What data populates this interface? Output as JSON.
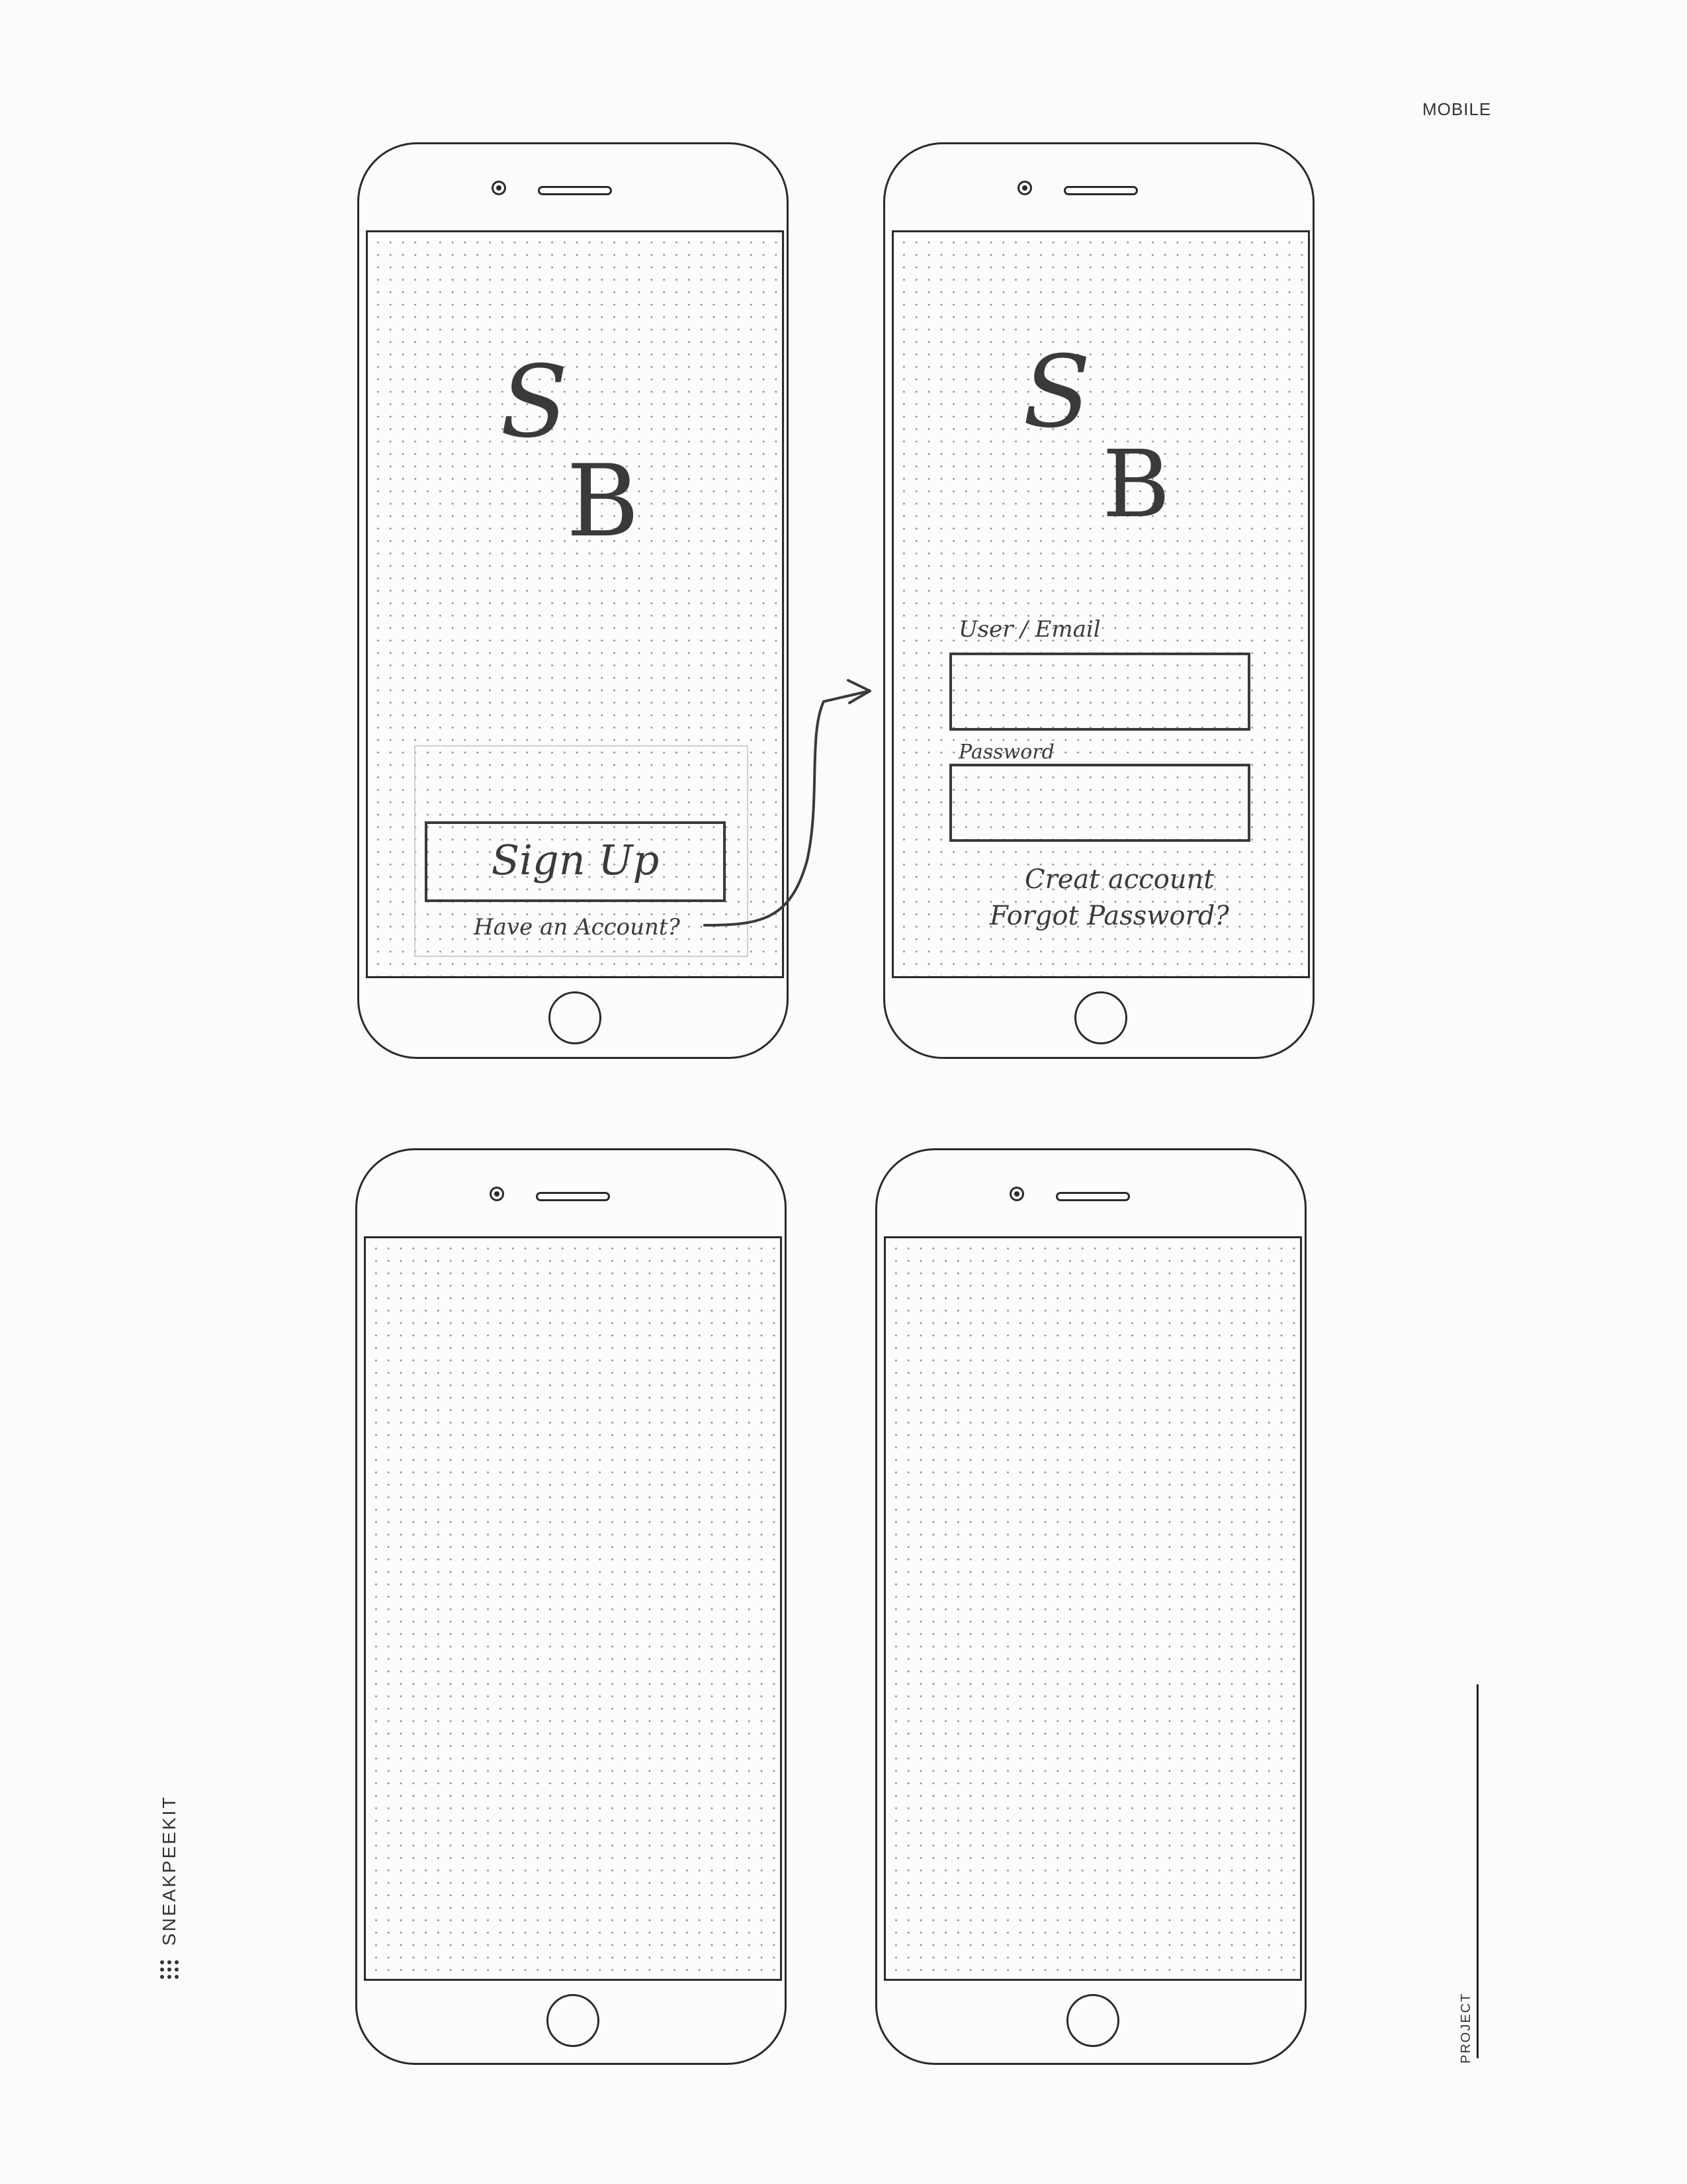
{
  "page": {
    "corner_label": "MOBILE",
    "brand": "SNEAKPEEKIT",
    "project_label": "PROJECT"
  },
  "screen1": {
    "logo_s": "S",
    "logo_b": "B",
    "signup_button": "Sign Up",
    "have_account_link": "Have an Account?"
  },
  "screen2": {
    "logo_s": "S",
    "logo_b": "B",
    "user_label": "User / Email",
    "password_label": "Password",
    "create_account_link": "Creat account",
    "forgot_password_link": "Forgot Password?"
  },
  "colors": {
    "ink": "#2a2a2a",
    "pencil": "#3a3a3a",
    "paper": "#fbfbfb"
  }
}
